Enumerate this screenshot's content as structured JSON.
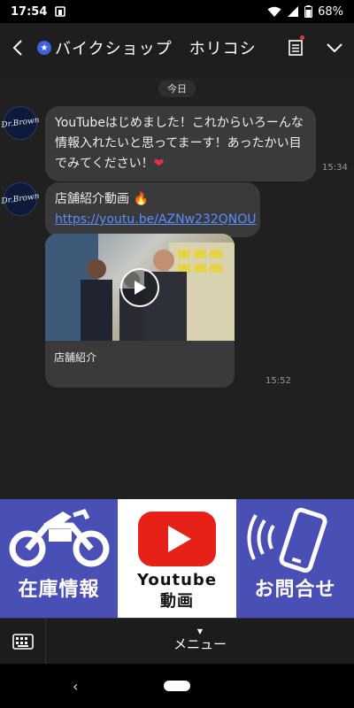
{
  "status": {
    "time": "17:54",
    "battery": "68%"
  },
  "header": {
    "title": "バイクショップ　ホリコシ"
  },
  "chat": {
    "date": "今日",
    "avatar_text": "Dr.Brown",
    "messages": [
      {
        "text": "YouTubeはじめました！これからいろーんな情報入れたいと思ってまーす！あったかい目でみてください！",
        "emoji": "❤",
        "time": "15:34"
      },
      {
        "text": "店舗紹介動画 🔥",
        "link": "https://youtu.be/AZNw232QNOU",
        "time": ""
      },
      {
        "video_caption": "店舗紹介",
        "time": "15:52"
      }
    ]
  },
  "rich_menu": {
    "left_label": "在庫情報",
    "mid_label_1": "Youtube",
    "mid_label_2": "動画",
    "right_label": "お問合せ"
  },
  "menu_bar": {
    "label": "メニュー"
  },
  "colors": {
    "menu_blue": "#4a4fb5",
    "youtube_red": "#e62117",
    "link": "#5b8cff"
  }
}
